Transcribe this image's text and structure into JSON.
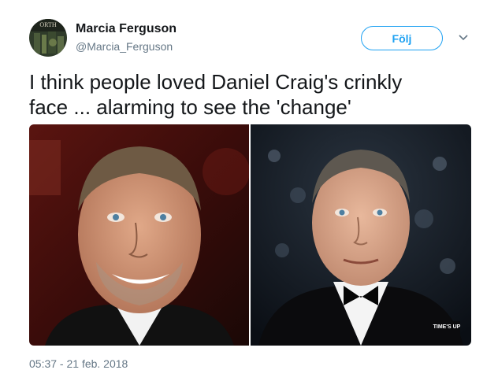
{
  "user": {
    "name": "Marcia Ferguson",
    "handle": "@Marcia_Ferguson"
  },
  "follow_button": {
    "label": "Följ"
  },
  "tweet": {
    "text": "I think people loved Daniel Craig's crinkly\nface ... alarming to see the 'change'",
    "timestamp": "05:37 - 21 feb. 2018"
  },
  "media": {
    "left_photo": "photo-man-smiling-red-background",
    "right_photo": "photo-man-tuxedo-stage",
    "badge_text": "TIME'S UP"
  },
  "colors": {
    "accent": "#1da1f2",
    "secondary_text": "#657786",
    "primary_text": "#14171a"
  }
}
